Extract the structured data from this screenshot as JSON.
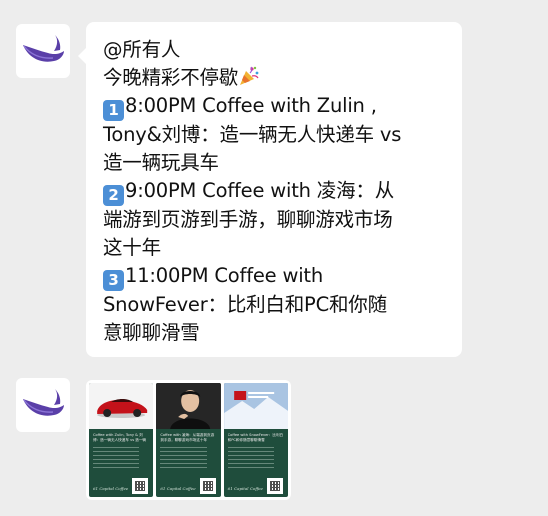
{
  "message1": {
    "lines": [
      {
        "text": "@所有人"
      },
      {
        "text": "今晚精彩不停歇",
        "emoji": "party-popper"
      },
      {
        "num": "1",
        "text": "8:00PM  Coffee with Zulin ,"
      },
      {
        "text": "Tony&刘博：造一辆无人快递车 vs"
      },
      {
        "text": "造一辆玩具车"
      },
      {
        "num": "2",
        "text": "9:00PM  Coffee with 凌海：从"
      },
      {
        "text": "端游到页游到手游，聊聊游戏市场"
      },
      {
        "text": "这十年"
      },
      {
        "num": "3",
        "text": "11:00PM  Coffee with"
      },
      {
        "text": "SnowFever：比利白和PC和你随"
      },
      {
        "text": "意聊聊滑雪"
      }
    ]
  },
  "message2": {
    "posters": [
      {
        "title": "Coffee with Zulin, Tony & 刘博：造一辆无人快递车 vs 造一辆玩具车",
        "footer": "61 Capital Coffee",
        "image": "red-car"
      },
      {
        "title": "Coffee with 凌海：从端游到页游到手游，聊聊游戏市场这十年",
        "footer": "61 Capital Coffee",
        "image": "portrait"
      },
      {
        "title": "Coffee with SnowFever：比利白和PC和你随意聊聊滑雪",
        "footer": "61 Capital Coffee",
        "image": "snow-fever"
      }
    ]
  },
  "colors": {
    "background": "#ededed",
    "bubble": "#ffffff",
    "keycap": "#4c8fd6",
    "poster": "#1f4d3c",
    "whale": "#5a3fa8"
  }
}
